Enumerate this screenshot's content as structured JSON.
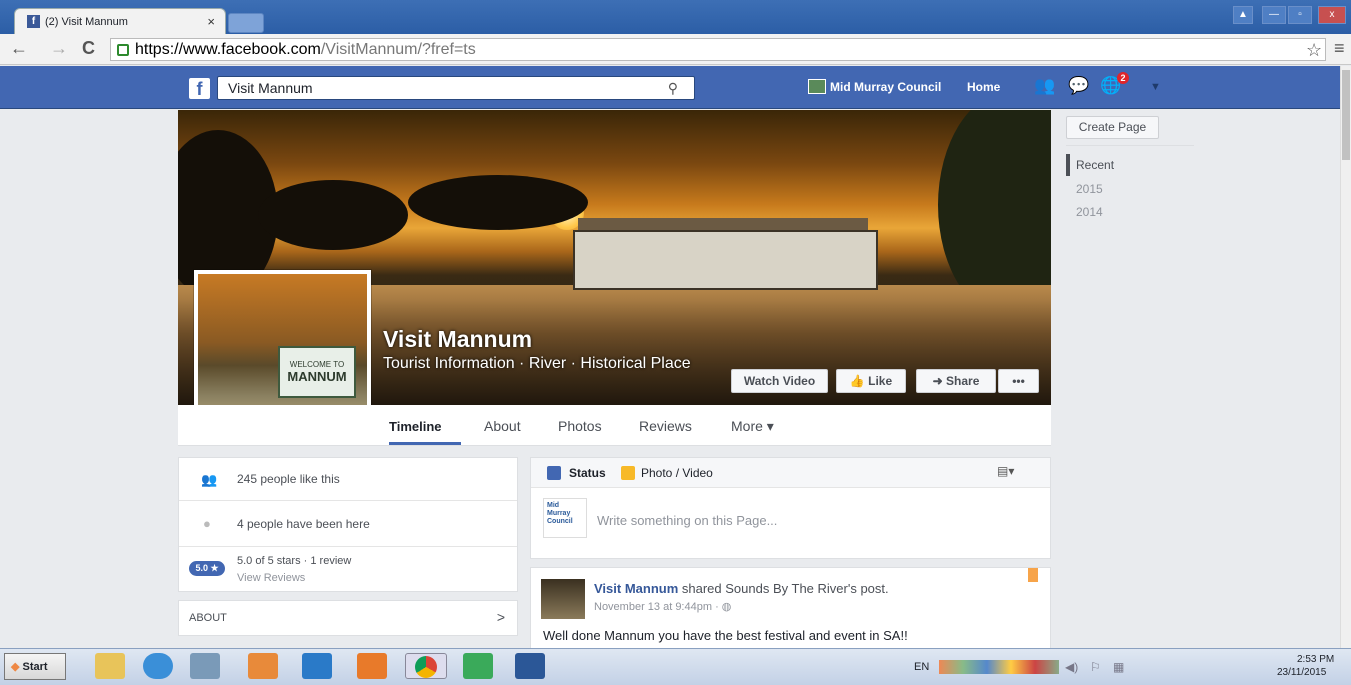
{
  "browser": {
    "tab_title": "(2) Visit Mannum",
    "tab_close": "×",
    "url_host": "https://www.facebook.com",
    "url_path": "/VisitMannum/?fref=ts",
    "back": "←",
    "forward": "→",
    "reload": "C",
    "star": "☆",
    "menu": "≡"
  },
  "fb": {
    "logo": "f",
    "search_value": "Visit Mannum",
    "search_icon": "⚲",
    "profile_name": "Mid Murray Council",
    "home": "Home",
    "notif_count": "2",
    "brand_color": "#4267b2"
  },
  "page": {
    "name": "Visit Mannum",
    "category": "Tourist Information · River · Historical Place",
    "watch_video": "Watch Video",
    "like": "Like",
    "share": "Share",
    "more_dots": "•••",
    "sign_welcome": "WELCOME TO",
    "sign_name": "MANNUM"
  },
  "tabs": [
    "Timeline",
    "About",
    "Photos",
    "Reviews",
    "More ▾"
  ],
  "left": {
    "likes": "245 people like this",
    "checkins": "4 people have been here",
    "rating_badge": "5.0 ★",
    "rating_text": "5.0 of 5 stars · 1 review",
    "view_reviews": "View Reviews",
    "about": "ABOUT",
    "chevron": ">"
  },
  "composer": {
    "status": "Status",
    "photo": "Photo / Video",
    "placeholder": "Write something on this Page...",
    "avatar_text": "Mid Murray Council"
  },
  "post": {
    "author": "Visit Mannum",
    "shared_text": " shared Sounds By The River's post.",
    "time": "November 13 at 9:44pm · ",
    "text": "Well done Mannum you have the best festival and event in SA!!"
  },
  "right": {
    "create_page": "Create Page",
    "years": [
      "Recent",
      "2015",
      "2014"
    ]
  },
  "taskbar": {
    "start": "Start",
    "lang": "EN",
    "time": "2:53 PM",
    "date": "23/11/2015"
  }
}
